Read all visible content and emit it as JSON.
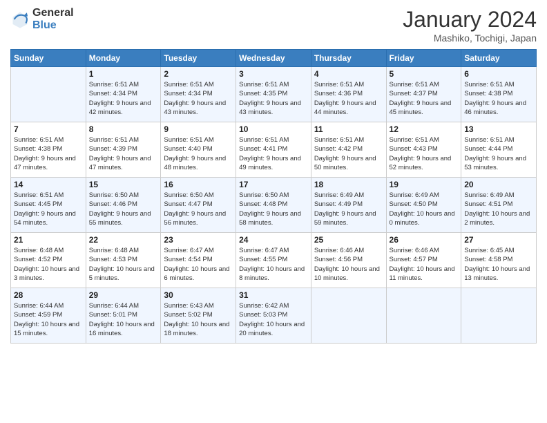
{
  "header": {
    "logo_general": "General",
    "logo_blue": "Blue",
    "month_title": "January 2024",
    "location": "Mashiko, Tochigi, Japan"
  },
  "weekdays": [
    "Sunday",
    "Monday",
    "Tuesday",
    "Wednesday",
    "Thursday",
    "Friday",
    "Saturday"
  ],
  "weeks": [
    [
      {
        "day": "",
        "sunrise": "",
        "sunset": "",
        "daylight": ""
      },
      {
        "day": "1",
        "sunrise": "Sunrise: 6:51 AM",
        "sunset": "Sunset: 4:34 PM",
        "daylight": "Daylight: 9 hours and 42 minutes."
      },
      {
        "day": "2",
        "sunrise": "Sunrise: 6:51 AM",
        "sunset": "Sunset: 4:34 PM",
        "daylight": "Daylight: 9 hours and 43 minutes."
      },
      {
        "day": "3",
        "sunrise": "Sunrise: 6:51 AM",
        "sunset": "Sunset: 4:35 PM",
        "daylight": "Daylight: 9 hours and 43 minutes."
      },
      {
        "day": "4",
        "sunrise": "Sunrise: 6:51 AM",
        "sunset": "Sunset: 4:36 PM",
        "daylight": "Daylight: 9 hours and 44 minutes."
      },
      {
        "day": "5",
        "sunrise": "Sunrise: 6:51 AM",
        "sunset": "Sunset: 4:37 PM",
        "daylight": "Daylight: 9 hours and 45 minutes."
      },
      {
        "day": "6",
        "sunrise": "Sunrise: 6:51 AM",
        "sunset": "Sunset: 4:38 PM",
        "daylight": "Daylight: 9 hours and 46 minutes."
      }
    ],
    [
      {
        "day": "7",
        "sunrise": "Sunrise: 6:51 AM",
        "sunset": "Sunset: 4:38 PM",
        "daylight": "Daylight: 9 hours and 47 minutes."
      },
      {
        "day": "8",
        "sunrise": "Sunrise: 6:51 AM",
        "sunset": "Sunset: 4:39 PM",
        "daylight": "Daylight: 9 hours and 47 minutes."
      },
      {
        "day": "9",
        "sunrise": "Sunrise: 6:51 AM",
        "sunset": "Sunset: 4:40 PM",
        "daylight": "Daylight: 9 hours and 48 minutes."
      },
      {
        "day": "10",
        "sunrise": "Sunrise: 6:51 AM",
        "sunset": "Sunset: 4:41 PM",
        "daylight": "Daylight: 9 hours and 49 minutes."
      },
      {
        "day": "11",
        "sunrise": "Sunrise: 6:51 AM",
        "sunset": "Sunset: 4:42 PM",
        "daylight": "Daylight: 9 hours and 50 minutes."
      },
      {
        "day": "12",
        "sunrise": "Sunrise: 6:51 AM",
        "sunset": "Sunset: 4:43 PM",
        "daylight": "Daylight: 9 hours and 52 minutes."
      },
      {
        "day": "13",
        "sunrise": "Sunrise: 6:51 AM",
        "sunset": "Sunset: 4:44 PM",
        "daylight": "Daylight: 9 hours and 53 minutes."
      }
    ],
    [
      {
        "day": "14",
        "sunrise": "Sunrise: 6:51 AM",
        "sunset": "Sunset: 4:45 PM",
        "daylight": "Daylight: 9 hours and 54 minutes."
      },
      {
        "day": "15",
        "sunrise": "Sunrise: 6:50 AM",
        "sunset": "Sunset: 4:46 PM",
        "daylight": "Daylight: 9 hours and 55 minutes."
      },
      {
        "day": "16",
        "sunrise": "Sunrise: 6:50 AM",
        "sunset": "Sunset: 4:47 PM",
        "daylight": "Daylight: 9 hours and 56 minutes."
      },
      {
        "day": "17",
        "sunrise": "Sunrise: 6:50 AM",
        "sunset": "Sunset: 4:48 PM",
        "daylight": "Daylight: 9 hours and 58 minutes."
      },
      {
        "day": "18",
        "sunrise": "Sunrise: 6:49 AM",
        "sunset": "Sunset: 4:49 PM",
        "daylight": "Daylight: 9 hours and 59 minutes."
      },
      {
        "day": "19",
        "sunrise": "Sunrise: 6:49 AM",
        "sunset": "Sunset: 4:50 PM",
        "daylight": "Daylight: 10 hours and 0 minutes."
      },
      {
        "day": "20",
        "sunrise": "Sunrise: 6:49 AM",
        "sunset": "Sunset: 4:51 PM",
        "daylight": "Daylight: 10 hours and 2 minutes."
      }
    ],
    [
      {
        "day": "21",
        "sunrise": "Sunrise: 6:48 AM",
        "sunset": "Sunset: 4:52 PM",
        "daylight": "Daylight: 10 hours and 3 minutes."
      },
      {
        "day": "22",
        "sunrise": "Sunrise: 6:48 AM",
        "sunset": "Sunset: 4:53 PM",
        "daylight": "Daylight: 10 hours and 5 minutes."
      },
      {
        "day": "23",
        "sunrise": "Sunrise: 6:47 AM",
        "sunset": "Sunset: 4:54 PM",
        "daylight": "Daylight: 10 hours and 6 minutes."
      },
      {
        "day": "24",
        "sunrise": "Sunrise: 6:47 AM",
        "sunset": "Sunset: 4:55 PM",
        "daylight": "Daylight: 10 hours and 8 minutes."
      },
      {
        "day": "25",
        "sunrise": "Sunrise: 6:46 AM",
        "sunset": "Sunset: 4:56 PM",
        "daylight": "Daylight: 10 hours and 10 minutes."
      },
      {
        "day": "26",
        "sunrise": "Sunrise: 6:46 AM",
        "sunset": "Sunset: 4:57 PM",
        "daylight": "Daylight: 10 hours and 11 minutes."
      },
      {
        "day": "27",
        "sunrise": "Sunrise: 6:45 AM",
        "sunset": "Sunset: 4:58 PM",
        "daylight": "Daylight: 10 hours and 13 minutes."
      }
    ],
    [
      {
        "day": "28",
        "sunrise": "Sunrise: 6:44 AM",
        "sunset": "Sunset: 4:59 PM",
        "daylight": "Daylight: 10 hours and 15 minutes."
      },
      {
        "day": "29",
        "sunrise": "Sunrise: 6:44 AM",
        "sunset": "Sunset: 5:01 PM",
        "daylight": "Daylight: 10 hours and 16 minutes."
      },
      {
        "day": "30",
        "sunrise": "Sunrise: 6:43 AM",
        "sunset": "Sunset: 5:02 PM",
        "daylight": "Daylight: 10 hours and 18 minutes."
      },
      {
        "day": "31",
        "sunrise": "Sunrise: 6:42 AM",
        "sunset": "Sunset: 5:03 PM",
        "daylight": "Daylight: 10 hours and 20 minutes."
      },
      {
        "day": "",
        "sunrise": "",
        "sunset": "",
        "daylight": ""
      },
      {
        "day": "",
        "sunrise": "",
        "sunset": "",
        "daylight": ""
      },
      {
        "day": "",
        "sunrise": "",
        "sunset": "",
        "daylight": ""
      }
    ]
  ]
}
